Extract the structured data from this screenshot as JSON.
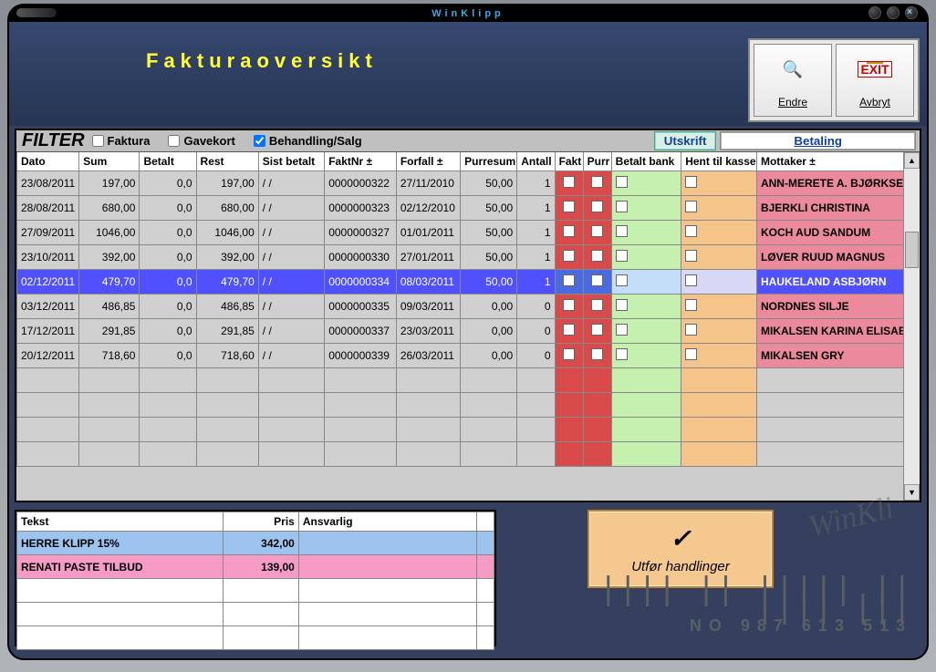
{
  "app": {
    "title": "WinKlipp"
  },
  "header": {
    "page_title": "Fakturaoversikt",
    "endre_label": "Endre",
    "avbryt_label": "Avbryt"
  },
  "filter": {
    "label": "FILTER",
    "faktura": "Faktura",
    "gavekort": "Gavekort",
    "behandling": "Behandling/Salg",
    "utskrift": "Utskrift",
    "betaling": "Betaling"
  },
  "columns": {
    "dato": "Dato",
    "sum": "Sum",
    "betalt": "Betalt",
    "rest": "Rest",
    "sist_betalt": "Sist betalt",
    "faktnr": "FaktNr ±",
    "forfall": "Forfall ±",
    "purresum": "Purresum",
    "antall": "Antall",
    "fakt": "Fakt",
    "purr": "Purr",
    "betalt_bank": "Betalt bank",
    "hent": "Hent til kasse",
    "mottaker": "Mottaker ±"
  },
  "rows": [
    {
      "dato": "23/08/2011",
      "sum": "197,00",
      "betalt": "0,0",
      "rest": "197,00",
      "sist": "/ /",
      "faktnr": "0000000322",
      "forfall": "27/11/2010",
      "purresum": "50,00",
      "antall": "1",
      "mottaker": "ANN-MERETE A. BJØRKSET"
    },
    {
      "dato": "28/08/2011",
      "sum": "680,00",
      "betalt": "0,0",
      "rest": "680,00",
      "sist": "/ /",
      "faktnr": "0000000323",
      "forfall": "02/12/2010",
      "purresum": "50,00",
      "antall": "1",
      "mottaker": "BJERKLI CHRISTINA"
    },
    {
      "dato": "27/09/2011",
      "sum": "1046,00",
      "betalt": "0,0",
      "rest": "1046,00",
      "sist": "/ /",
      "faktnr": "0000000327",
      "forfall": "01/01/2011",
      "purresum": "50,00",
      "antall": "1",
      "mottaker": "KOCH AUD SANDUM"
    },
    {
      "dato": "23/10/2011",
      "sum": "392,00",
      "betalt": "0,0",
      "rest": "392,00",
      "sist": "/ /",
      "faktnr": "0000000330",
      "forfall": "27/01/2011",
      "purresum": "50,00",
      "antall": "1",
      "mottaker": "LØVER RUUD MAGNUS"
    },
    {
      "dato": "02/12/2011",
      "sum": "479,70",
      "betalt": "0,0",
      "rest": "479,70",
      "sist": "/ /",
      "faktnr": "0000000334",
      "forfall": "08/03/2011",
      "purresum": "50,00",
      "antall": "1",
      "mottaker": "HAUKELAND ASBJØRN",
      "selected": true
    },
    {
      "dato": "03/12/2011",
      "sum": "486,85",
      "betalt": "0,0",
      "rest": "486,85",
      "sist": "/ /",
      "faktnr": "0000000335",
      "forfall": "09/03/2011",
      "purresum": "0,00",
      "antall": "0",
      "mottaker": "NORDNES SILJE"
    },
    {
      "dato": "17/12/2011",
      "sum": "291,85",
      "betalt": "0,0",
      "rest": "291,85",
      "sist": "/ /",
      "faktnr": "0000000337",
      "forfall": "23/03/2011",
      "purresum": "0,00",
      "antall": "0",
      "mottaker": "MIKALSEN KARINA ELISAB"
    },
    {
      "dato": "20/12/2011",
      "sum": "718,60",
      "betalt": "0,0",
      "rest": "718,60",
      "sist": "/ /",
      "faktnr": "0000000339",
      "forfall": "26/03/2011",
      "purresum": "0,00",
      "antall": "0",
      "mottaker": "MIKALSEN GRY"
    }
  ],
  "detail": {
    "cols": {
      "tekst": "Tekst",
      "pris": "Pris",
      "ansvarlig": "Ansvarlig"
    },
    "rows": [
      {
        "tekst": "HERRE KLIPP 15%",
        "pris": "342,00",
        "cls": "blue-row"
      },
      {
        "tekst": "RENATI PASTE TILBUD",
        "pris": "139,00",
        "cls": "pink-row"
      }
    ]
  },
  "action": {
    "label": "Utfør handlinger"
  },
  "footer": {
    "barcode_text": "NO 987 613 513",
    "watermark": "WinKli"
  }
}
